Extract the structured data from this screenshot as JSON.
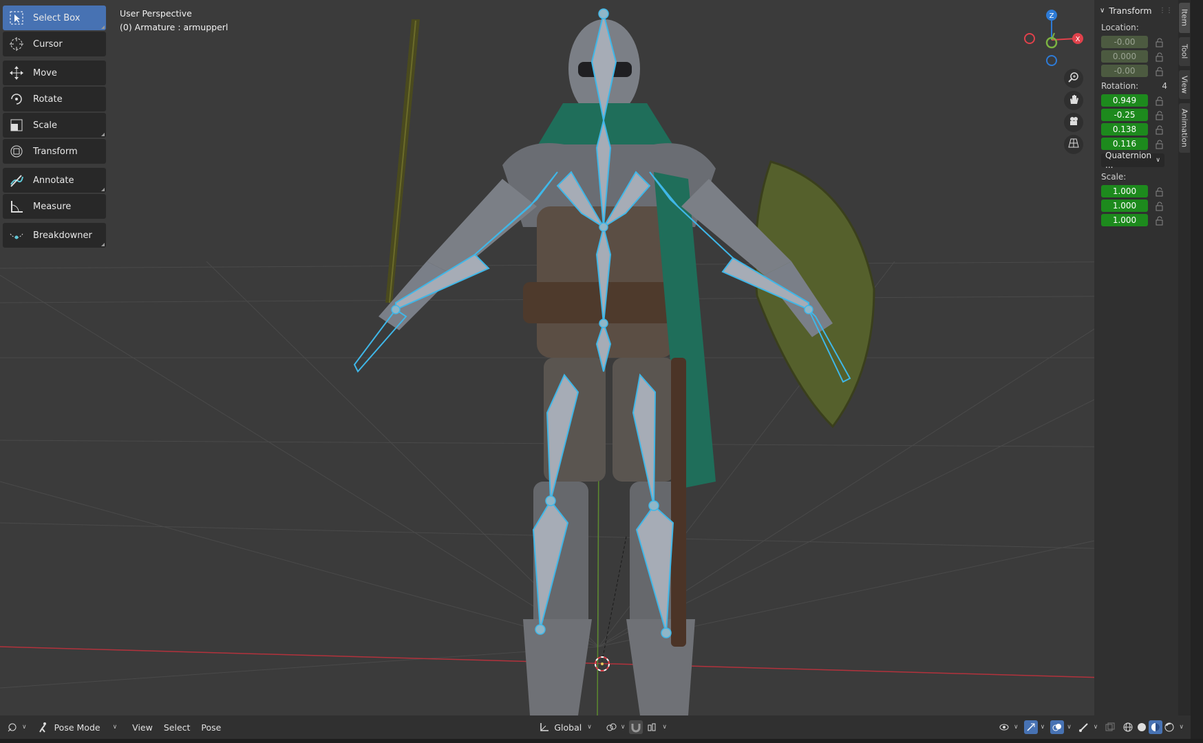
{
  "viewport": {
    "perspective": "User Perspective",
    "context": "(0) Armature : armupperl"
  },
  "toolbar": {
    "tools": [
      {
        "label": "Select Box",
        "icon": "select-box-icon"
      },
      {
        "label": "Cursor",
        "icon": "cursor-icon"
      },
      {
        "label": "Move",
        "icon": "move-icon"
      },
      {
        "label": "Rotate",
        "icon": "rotate-icon"
      },
      {
        "label": "Scale",
        "icon": "scale-icon"
      },
      {
        "label": "Transform",
        "icon": "transform-icon"
      },
      {
        "label": "Annotate",
        "icon": "annotate-icon"
      },
      {
        "label": "Measure",
        "icon": "measure-icon"
      },
      {
        "label": "Breakdowner",
        "icon": "breakdowner-icon"
      }
    ]
  },
  "gizmo": {
    "z": "Z",
    "x": "X"
  },
  "npanel": {
    "title": "Transform",
    "location_label": "Location:",
    "location": [
      "-0.00",
      "0.000",
      "-0.00"
    ],
    "rotation_label": "Rotation:",
    "rotation_mode_count": "4",
    "rotation": [
      "0.949",
      "-0.25",
      "0.138",
      "0.116"
    ],
    "rotation_mode": "Quaternion ...",
    "scale_label": "Scale:",
    "scale": [
      "1.000",
      "1.000",
      "1.000"
    ]
  },
  "sidetabs": [
    "Item",
    "Tool",
    "View",
    "Animation"
  ],
  "statusbar": {
    "mode": "Pose Mode",
    "menu_view": "View",
    "menu_select": "Select",
    "menu_pose": "Pose",
    "orientation": "Global"
  },
  "colors": {
    "active": "#4772b3",
    "field_green": "#1d8a1d",
    "axis_x": "#e0414b",
    "axis_y": "#7cb342",
    "axis_z": "#2e7bd6",
    "bone_outline": "#3fb7e8"
  }
}
